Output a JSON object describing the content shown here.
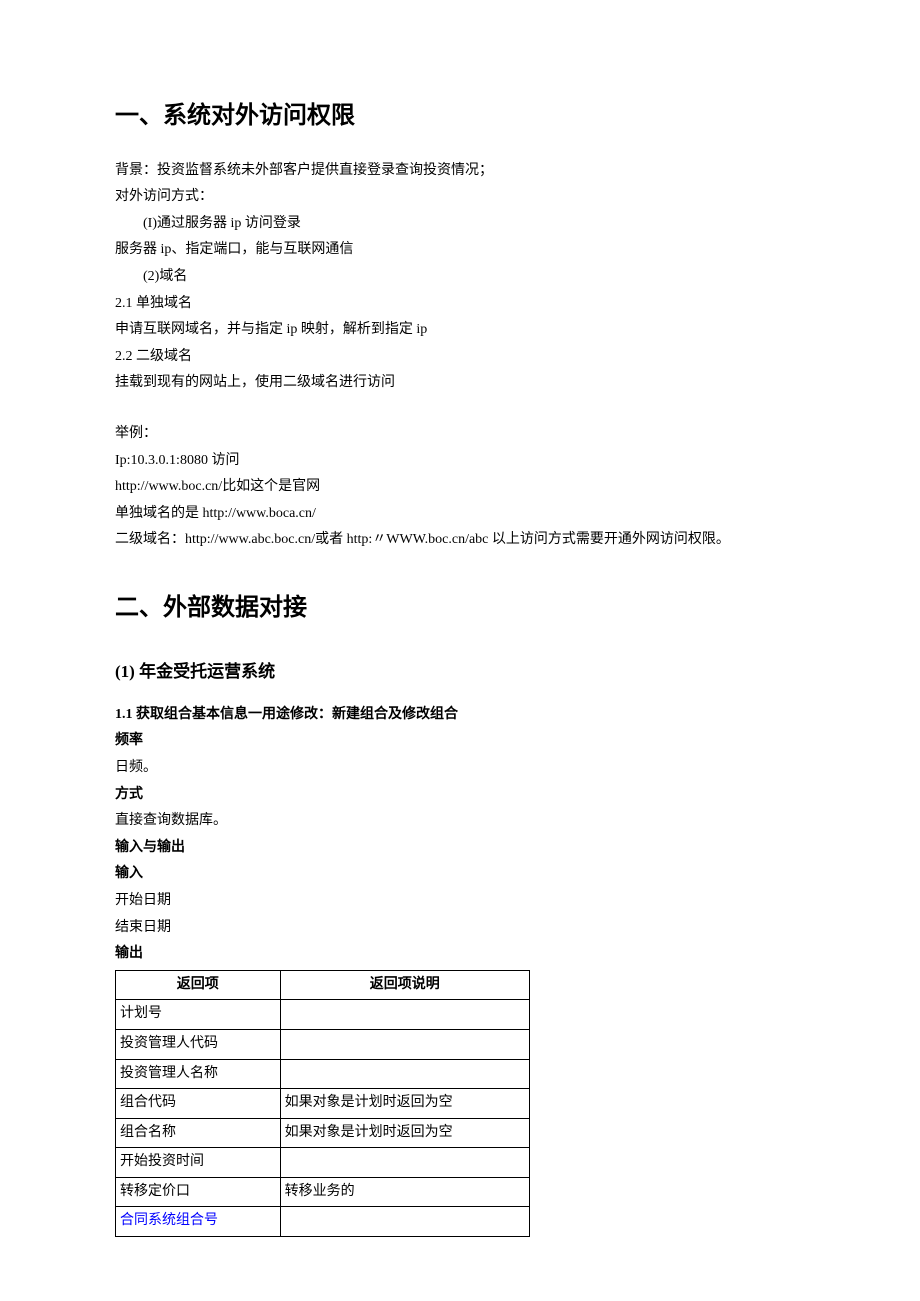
{
  "section1": {
    "title": "一、系统对外访问权限",
    "p1": "背景：投资监督系统未外部客户提供直接登录查询投资情况；",
    "p2": "对外访问方式：",
    "p3": "(I)通过服务器 ip 访问登录",
    "p4": "服务器 ip、指定端口，能与互联网通信",
    "p5": "(2)域名",
    "p6": "2.1  单独域名",
    "p7": "申请互联网域名，并与指定 ip 映射，解析到指定 ip",
    "p8": "2.2  二级域名",
    "p9": "挂载到现有的网站上，使用二级域名进行访问",
    "p10": "举例：",
    "p11": "Ip:10.3.0.1:8080 访问",
    "p12": "http://www.boc.cn/比如这个是官网",
    "p13": "单独域名的是 http://www.boca.cn/",
    "p14": "二级域名：http://www.abc.boc.cn/或者 http:〃WWW.boc.cn/abc 以上访问方式需要开通外网访问权限。"
  },
  "section2": {
    "title": "二、外部数据对接",
    "sub1": {
      "title": "(1) 年金受托运营系统",
      "item1_1": "1.1   获取组合基本信息一用途修改：新建组合及修改组合",
      "freq_label": "频率",
      "freq_value": "日频。",
      "method_label": "方式",
      "method_value": "直接查询数据库。",
      "io_label": "输入与输出",
      "input_label": "输入",
      "input1": "开始日期",
      "input2": "结束日期",
      "output_label": "输出",
      "table": {
        "header": {
          "c1": "返回项",
          "c2": "返回项说明"
        },
        "rows": [
          {
            "c1": "计划号",
            "c2": ""
          },
          {
            "c1": "投资管理人代码",
            "c2": ""
          },
          {
            "c1": "投资管理人名称",
            "c2": ""
          },
          {
            "c1": "组合代码",
            "c2": "如果对象是计划时返回为空"
          },
          {
            "c1": "组合名称",
            "c2": "如果对象是计划时返回为空"
          },
          {
            "c1": "开始投资时间",
            "c2": ""
          },
          {
            "c1": "转移定价口",
            "c2": "转移业务的"
          },
          {
            "c1": "合同系统组合号",
            "c2": "",
            "blue": true
          }
        ]
      }
    }
  }
}
